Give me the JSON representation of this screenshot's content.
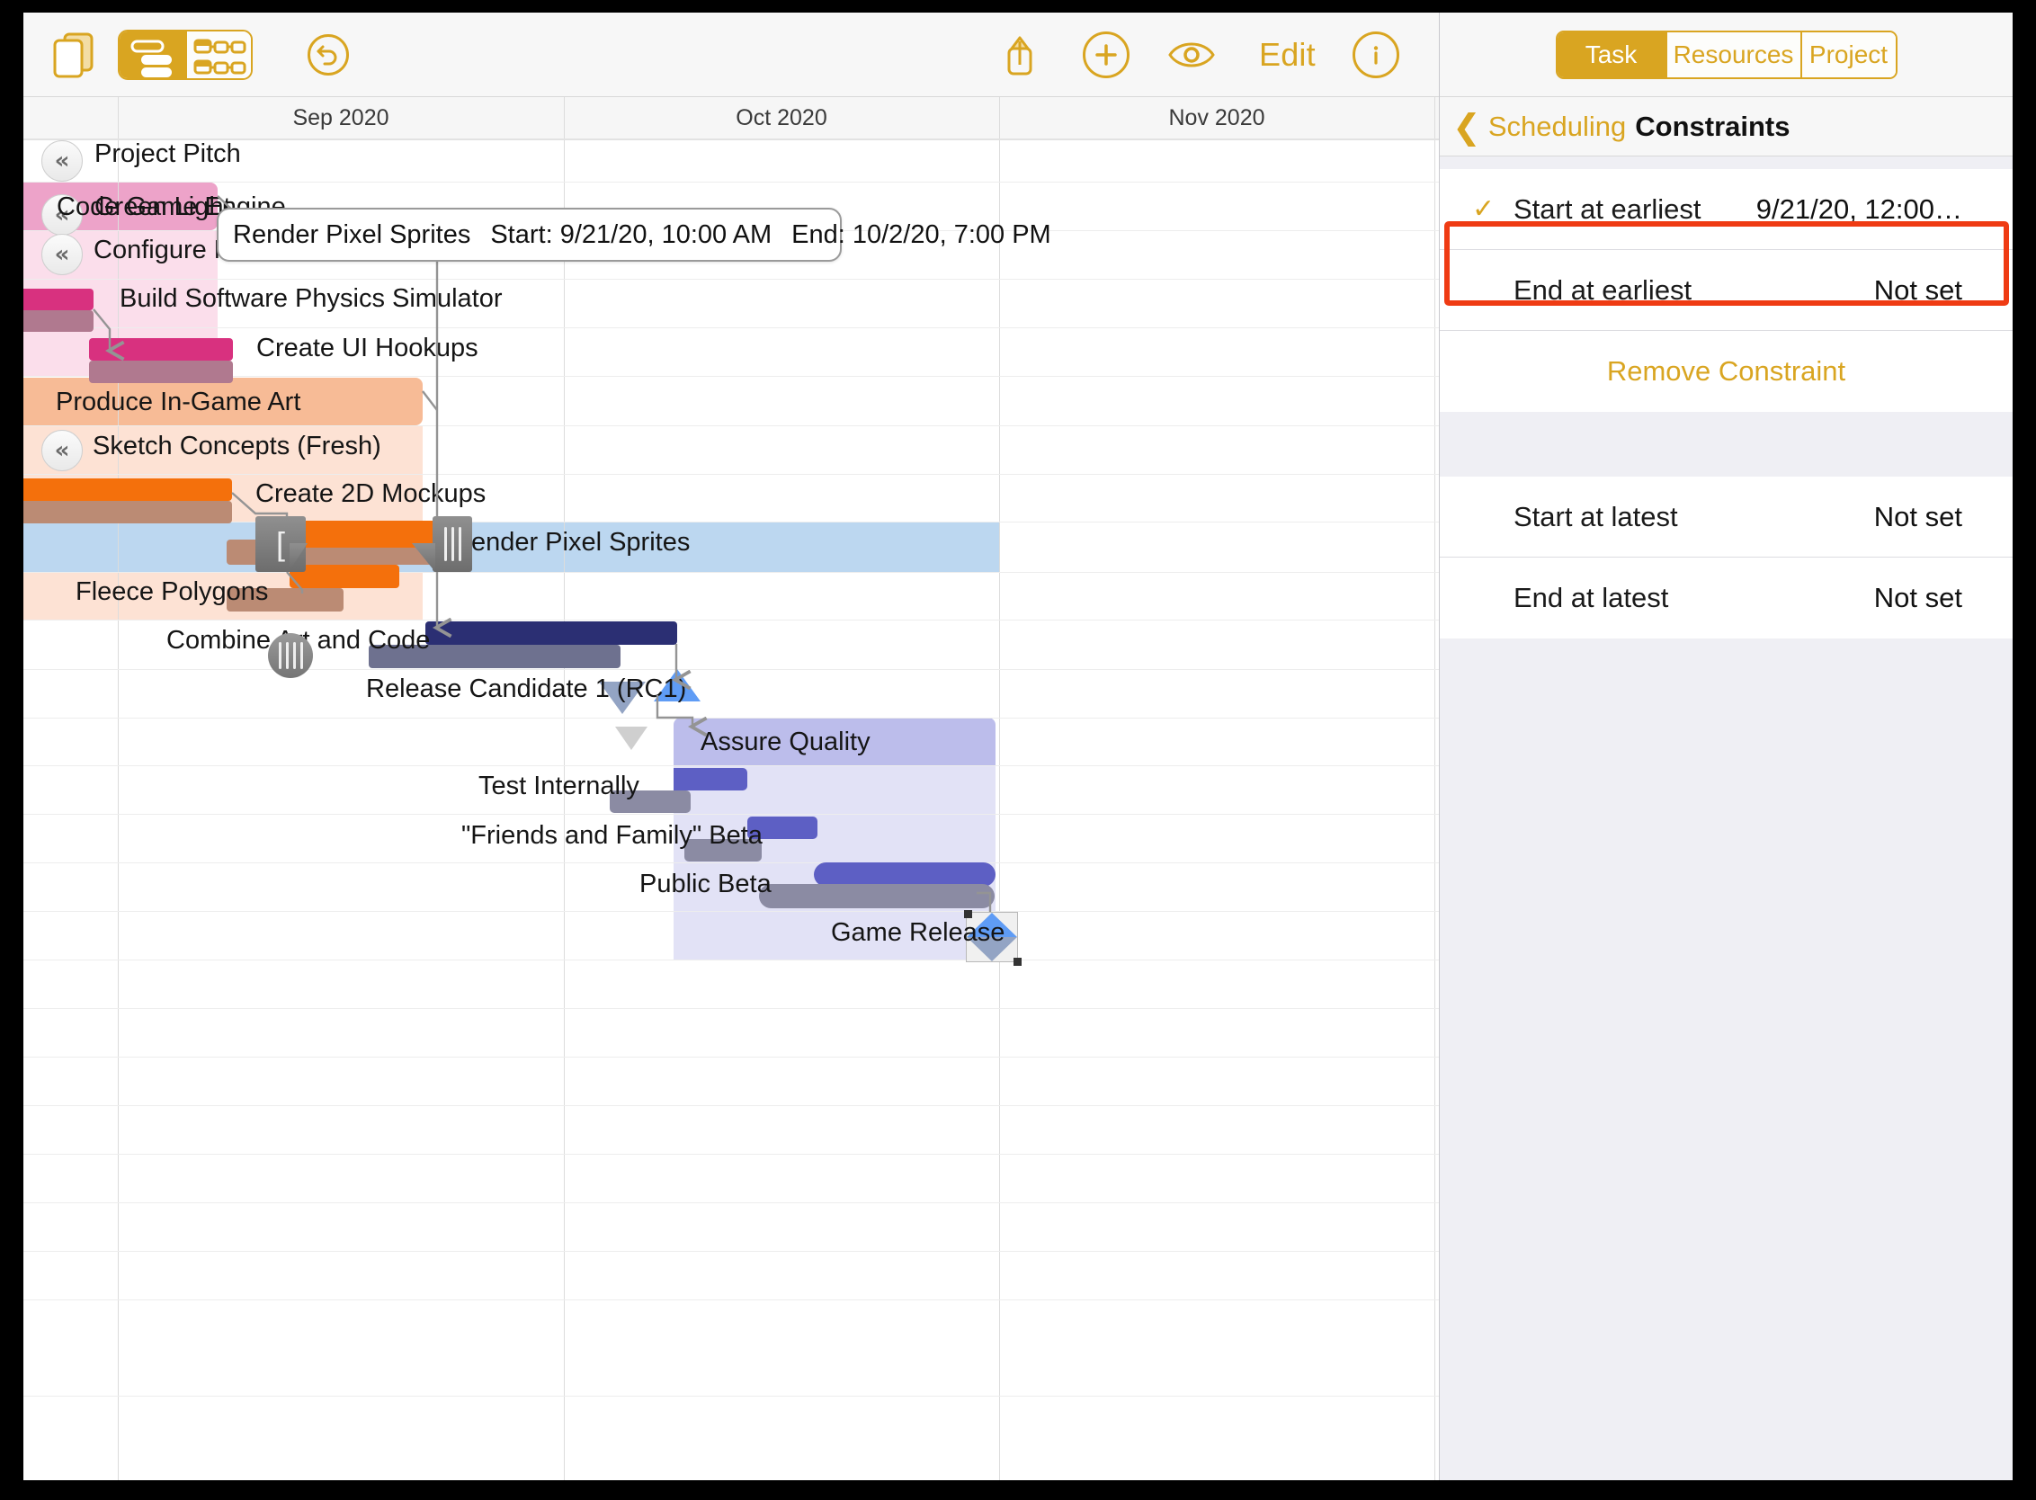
{
  "toolbar": {
    "icons": [
      {
        "name": "documents-icon",
        "label": "Documents"
      },
      {
        "name": "view-switch",
        "label": "View"
      },
      {
        "name": "undo-icon",
        "label": "Undo"
      },
      {
        "name": "share-icon",
        "label": "Share"
      },
      {
        "name": "add-icon",
        "label": "Add"
      },
      {
        "name": "view-eye-icon",
        "label": "View Options"
      },
      {
        "name": "info-icon",
        "label": "Info"
      }
    ],
    "edit_label": "Edit"
  },
  "inspector": {
    "tabs": [
      {
        "label": "Task",
        "active": true
      },
      {
        "label": "Resources",
        "active": false
      },
      {
        "label": "Project",
        "active": false
      }
    ],
    "nav": {
      "back": "‹",
      "parent": "Scheduling",
      "title": "Constraints"
    },
    "group_one": [
      {
        "label": "Start at earliest",
        "value": "9/21/20, 12:00…",
        "checked": "✓",
        "highlighted": true
      },
      {
        "label": "End at earliest",
        "value": "Not set",
        "checked": "",
        "highlighted": false
      }
    ],
    "action_label": "Remove Constraint",
    "group_two": [
      {
        "label": "Start at latest",
        "value": "Not set"
      },
      {
        "label": "End at latest",
        "value": "Not set"
      }
    ]
  },
  "gantt": {
    "months": [
      "Sep 2020",
      "Oct 2020",
      "Nov 2020"
    ],
    "tooltip": {
      "name": "Render Pixel Sprites",
      "start": "Start: 9/21/20, 10:00 AM",
      "end": "End: 10/2/20, 7:00 PM"
    },
    "rows": [
      {
        "label": "Project Pitch",
        "type": "task",
        "partial": true,
        "collapse": true
      },
      {
        "label": "Green Light",
        "type": "milestone",
        "collapse": true
      },
      {
        "label": "Code Game Engine",
        "type": "group"
      },
      {
        "label": "Configure Middleware",
        "type": "task",
        "collapse": true
      },
      {
        "label": "Build Software Physics Simulator",
        "type": "task"
      },
      {
        "label": "Create UI Hookups",
        "type": "task"
      },
      {
        "label": "Produce In-Game Art",
        "type": "group"
      },
      {
        "label": "Sketch Concepts (Fresh)",
        "type": "task",
        "collapse": true
      },
      {
        "label": "Create 2D Mockups",
        "type": "task"
      },
      {
        "label": "Render Pixel Sprites",
        "type": "task",
        "selected": true
      },
      {
        "label": "Fleece Polygons",
        "type": "task"
      },
      {
        "label": "Combine Art and Code",
        "type": "task"
      },
      {
        "label": "Release Candidate 1 (RC1)",
        "type": "milestone"
      },
      {
        "label": "Assure Quality",
        "type": "group"
      },
      {
        "label": "Test Internally",
        "type": "task"
      },
      {
        "label": "\"Friends and Family\" Beta",
        "type": "task"
      },
      {
        "label": "Public Beta",
        "type": "task"
      },
      {
        "label": "Game Release",
        "type": "milestone"
      }
    ],
    "colors": {
      "pink_group": "#eda3c9",
      "pink_band": "#fbdeeb",
      "pink_bar": "#d8317f",
      "pink_shadow": "#b0798f",
      "orange_group": "#f7bb96",
      "orange_band": "#fde2d4",
      "orange_bar": "#f4700c",
      "orange_shadow": "#bb8b74",
      "navy_bar": "#2b2f73",
      "navy_shadow": "#6e718f",
      "purple_group": "#bcbdeb",
      "purple_band": "#e2e2f6",
      "purple_bar": "#5d5fc4",
      "purple_shadow": "#8b8ba3",
      "selection": "#bcd7f0",
      "milestone_blue": "#5f9cf5",
      "milestone_shadow": "#93a4c4"
    }
  }
}
